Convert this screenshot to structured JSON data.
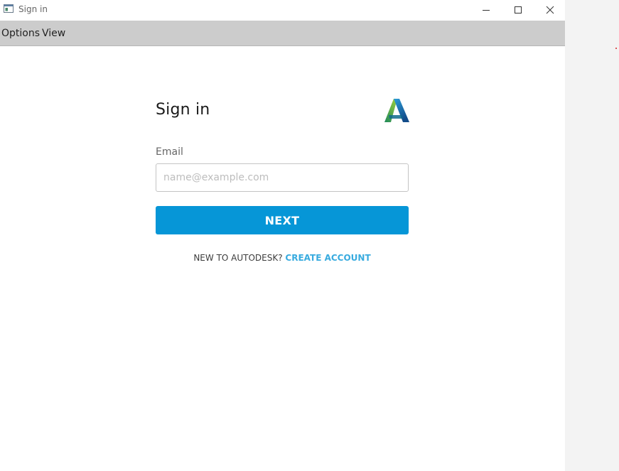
{
  "window": {
    "title": "Sign in"
  },
  "menu": {
    "options_label": "Options",
    "view_label": "View"
  },
  "signin": {
    "heading": "Sign in",
    "email_label": "Email",
    "email_placeholder": "name@example.com",
    "email_value": "",
    "next_label": "NEXT",
    "new_account_text": "NEW TO AUTODESK?",
    "create_account_label": "CREATE ACCOUNT"
  },
  "icons": {
    "app": "app-window-icon",
    "minimize": "minimize-icon",
    "maximize": "maximize-icon",
    "close": "close-icon",
    "logo": "autodesk-logo"
  },
  "colors": {
    "primary_button": "#0696d7",
    "link": "#38abdf",
    "menu_bar": "#cccccc",
    "page_background": "#f3f3f3",
    "window_background": "#ffffff",
    "indicator_dot": "#cc0000"
  }
}
